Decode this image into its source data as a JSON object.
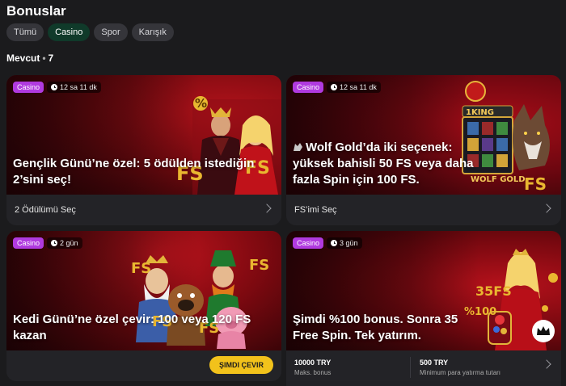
{
  "page": {
    "title": "Bonuslar"
  },
  "filters": [
    {
      "label": "Tümü",
      "active": false
    },
    {
      "label": "Casino",
      "active": true
    },
    {
      "label": "Spor",
      "active": false
    },
    {
      "label": "Karışık",
      "active": false
    }
  ],
  "section": {
    "label": "Mevcut",
    "count": "7"
  },
  "cards": [
    {
      "tag": "Casino",
      "time": "12 sa 11 dk",
      "headline": "Gençlik Günü’ne özel: 5 ödülden istediğin 2’sini seç!",
      "footer_label": "2 Ödülümü Seç",
      "icon": "chevron-right-icon"
    },
    {
      "tag": "Casino",
      "time": "12 sa 11 dk",
      "headline": "Wolf Gold’da iki seçenek: yüksek bahisli 50 FS veya daha fazla Spin için 100 FS.",
      "footer_label": "FS’imi Seç",
      "icon": "chevron-right-icon"
    },
    {
      "tag": "Casino",
      "time": "2 gün",
      "headline": "Kedi Günü’ne özel çevir: 100 veya 120 FS kazan",
      "button_label": "ŞIMDI ÇEVIR"
    },
    {
      "tag": "Casino",
      "time": "3 gün",
      "headline": "Şimdi %100 bonus. Sonra 35 Free Spin. Tek yatırım.",
      "stats": [
        {
          "value": "10000 TRY",
          "caption": "Maks. bonus"
        },
        {
          "value": "500 TRY",
          "caption": "Minimum para yatırma tutarı"
        }
      ],
      "icon": "chevron-right-icon"
    }
  ],
  "art_text": {
    "percent": "%",
    "fs": "FS",
    "king": "1KING",
    "wolf_gold": "WOLF GOLD",
    "spins": "35FS",
    "bonus": "%100"
  },
  "colors": {
    "accent_green": "#103a2a",
    "tag_purple": "#b03adf",
    "button_yellow": "#f2c21b",
    "background": "#1b1b1d"
  }
}
